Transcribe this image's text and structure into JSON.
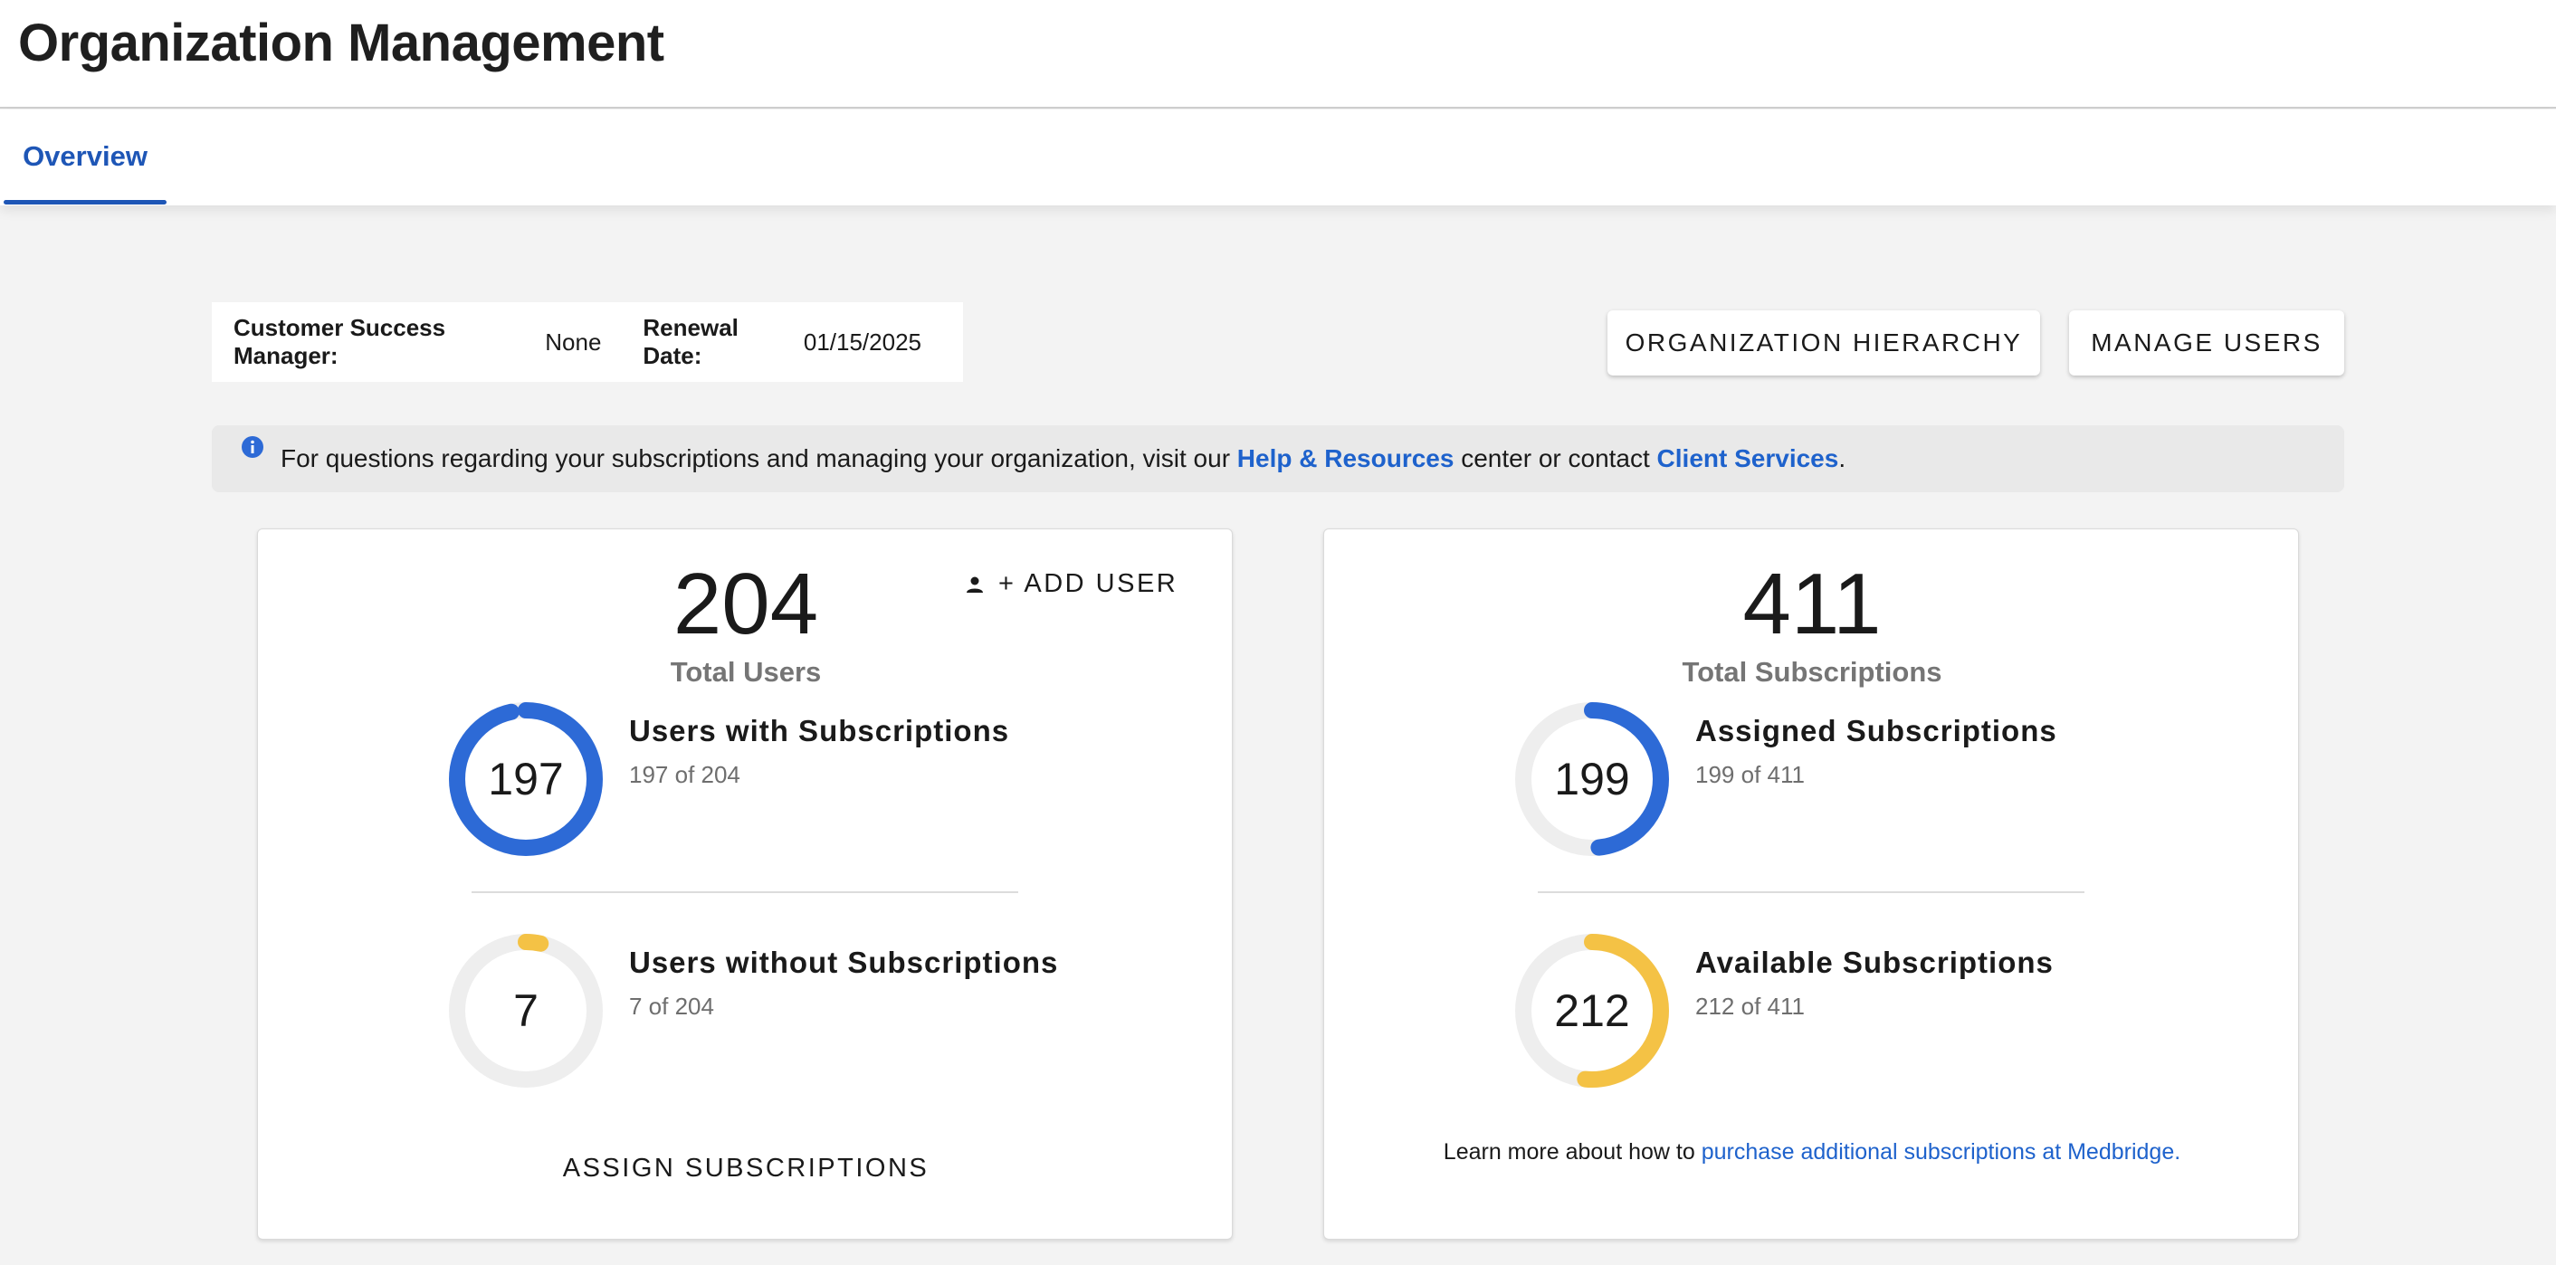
{
  "page": {
    "title": "Organization Management"
  },
  "tabs": [
    {
      "label": "Overview",
      "active": true
    }
  ],
  "org_info": {
    "csm_label": "Customer Success Manager:",
    "csm_value": "None",
    "renewal_label": "Renewal Date:",
    "renewal_value": "01/15/2025"
  },
  "actions": {
    "hierarchy_label": "ORGANIZATION HIERARCHY",
    "manage_users_label": "MANAGE USERS"
  },
  "notice": {
    "text_before": "For questions regarding your subscriptions and managing your organization, visit our ",
    "link1": "Help & Resources",
    "text_middle": " center or contact ",
    "link2": "Client Services",
    "text_after": "."
  },
  "users_card": {
    "total": "204",
    "total_label": "Total Users",
    "add_user_label": "+ ADD USER",
    "with": {
      "value": "197",
      "title": "Users with Subscriptions",
      "sub": "197 of 204",
      "fraction": 0.9657
    },
    "without": {
      "value": "7",
      "title": "Users without Subscriptions",
      "sub": "7 of 204",
      "fraction": 0.0343
    },
    "assign_label": "ASSIGN SUBSCRIPTIONS"
  },
  "subs_card": {
    "total": "411",
    "total_label": "Total Subscriptions",
    "assigned": {
      "value": "199",
      "title": "Assigned Subscriptions",
      "sub": "199 of 411",
      "fraction": 0.4842
    },
    "available": {
      "value": "212",
      "title": "Available Subscriptions",
      "sub": "212 of 411",
      "fraction": 0.5158
    },
    "learn_text": "Learn more about how to ",
    "learn_link": "purchase additional subscriptions at Medbridge."
  },
  "colors": {
    "accent_blue": "#2d6ad6",
    "accent_yellow": "#f4c245",
    "ring_track": "#eeeeee",
    "link": "#1e62cc"
  },
  "icons": [
    "info-icon",
    "person-icon"
  ]
}
